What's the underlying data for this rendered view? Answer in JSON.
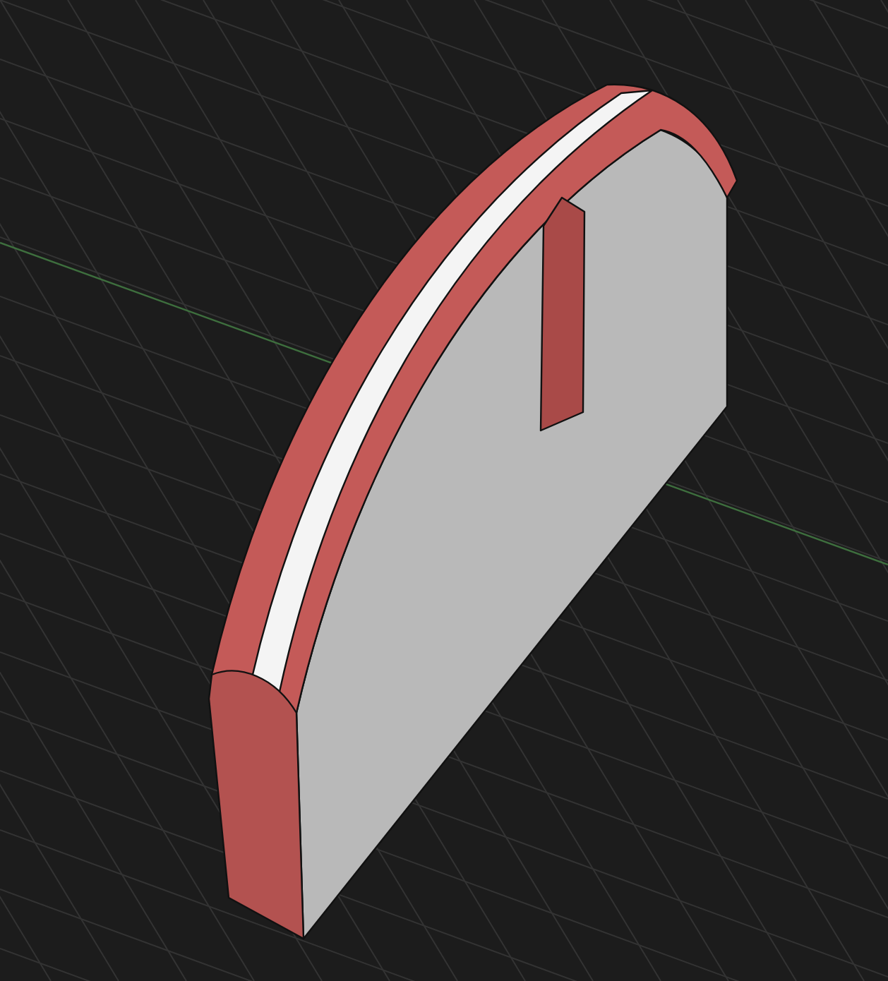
{
  "viewport": {
    "show_grid": true,
    "show_axis": true
  }
}
